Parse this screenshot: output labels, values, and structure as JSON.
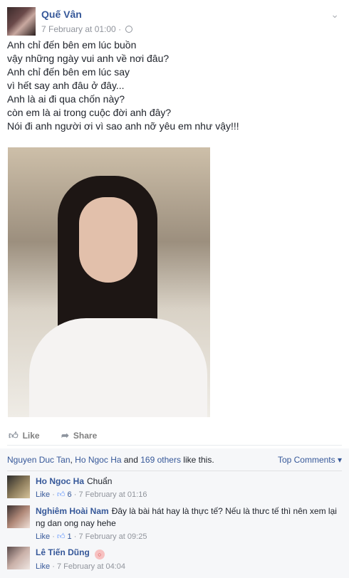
{
  "post": {
    "author": "Quế Vân",
    "timestamp": "7 February at 01:00",
    "dot": "·",
    "lines": [
      "Anh chỉ đến bên em lúc buồn",
      "vậy những ngày vui anh về nơi đâu?",
      "Anh chỉ đến bên em lúc say",
      "vì hết say anh đâu ở đây...",
      "Anh là ai đi qua chốn này?",
      "còn em là ai trong cuộc đời anh đây?",
      "Nói đi anh người ơi vì sao anh nỡ yêu em như vậy!!!"
    ]
  },
  "actions": {
    "like_label": "Like",
    "share_label": "Share"
  },
  "summary": {
    "name1": "Nguyen Duc Tan",
    "sep1": ", ",
    "name2": "Ho Ngoc Ha",
    "and": " and ",
    "others": "169 others",
    "tail": " like this.",
    "top_comments": "Top Comments ▾"
  },
  "comments": [
    {
      "name": "Ho Ngoc Ha",
      "text": "Chuẩn",
      "like": "Like",
      "dot": " · ",
      "likes_count": "6",
      "time": "7 February at 01:16"
    },
    {
      "name": "Nghiêm Hoài Nam",
      "text": "Đây là bài hát hay là thực tế? Nếu là thưc tế thì nên xem lại ng dan ong nay hehe",
      "like": "Like",
      "dot": " · ",
      "likes_count": "1",
      "time": "7 February at 09:25"
    },
    {
      "name": "Lê Tiến Dũng",
      "text": "",
      "like": "Like",
      "dot": " · ",
      "time": "7 February at 04:04"
    }
  ],
  "icons": {
    "globe": "globe-icon",
    "chevron": "chevron-down-icon",
    "like": "thumbs-up-icon",
    "share": "share-arrow-icon"
  },
  "colors": {
    "link": "#365899",
    "meta": "#90949c",
    "comments_bg": "#f6f7f9"
  }
}
